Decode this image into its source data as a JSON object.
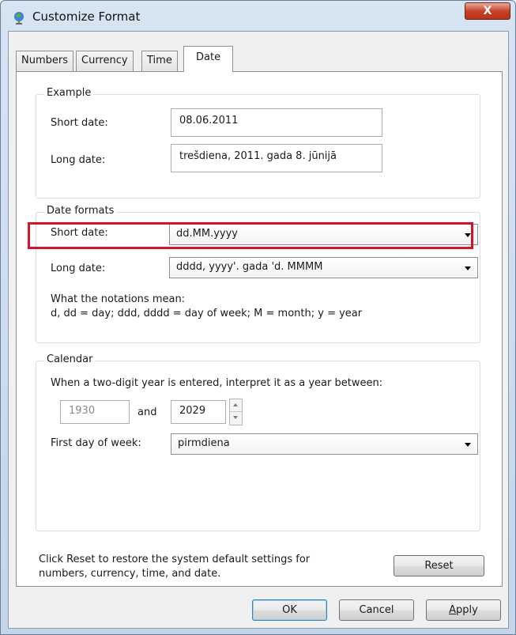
{
  "window": {
    "title": "Customize Format",
    "close_label": "X"
  },
  "tabs": [
    {
      "label": "Numbers"
    },
    {
      "label": "Currency"
    },
    {
      "label": "Time"
    },
    {
      "label": "Date",
      "selected": true
    }
  ],
  "example": {
    "title": "Example",
    "short_label": "Short date:",
    "short_value": "08.06.2011",
    "long_label": "Long date:",
    "long_value": "trešdiena, 2011. gada 8. jūnijā"
  },
  "date_formats": {
    "title": "Date formats",
    "short_label": "Short date:",
    "short_value": "dd.MM.yyyy",
    "long_label": "Long date:",
    "long_value": "dddd, yyyy'. gada 'd. MMMM",
    "notation_title": "What the notations mean:",
    "notation_text": "d, dd = day;  ddd, dddd = day of week;  M = month;  y = year"
  },
  "calendar": {
    "title": "Calendar",
    "two_digit_text": "When a two-digit year is entered, interpret it as a year between:",
    "year_from": "1930",
    "and_label": "and",
    "year_to": "2029",
    "first_day_label": "First day of week:",
    "first_day_value": "pirmdiena"
  },
  "reset": {
    "text_line1": "Click Reset to restore the system default settings for",
    "text_line2": "numbers, currency, time, and date.",
    "button_label": "Reset"
  },
  "footer": {
    "ok_label": "OK",
    "cancel_label": "Cancel",
    "apply_label": "Apply"
  },
  "colors": {
    "highlight": "#d3152a",
    "close_button": "#c8432a"
  }
}
